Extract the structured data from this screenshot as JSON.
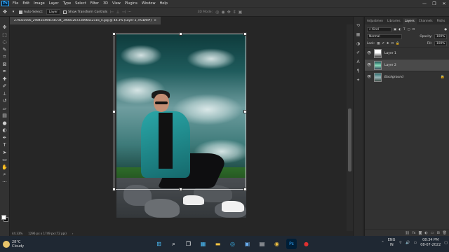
{
  "menubar": {
    "logo": "Ps",
    "items": [
      "File",
      "Edit",
      "Image",
      "Layer",
      "Type",
      "Select",
      "Filter",
      "3D",
      "View",
      "Plugins",
      "Window",
      "Help"
    ],
    "win_controls": [
      "—",
      "❐",
      "✕"
    ]
  },
  "options": {
    "auto_select_label": "Auto-Select:",
    "auto_select_value": "Layer",
    "transform_controls_label": "Show Transform Controls",
    "mode3d_label": "3D Mode:"
  },
  "document": {
    "tab_title": "274331056_298415494158734_3908126722896512116_n.jpg @ 44.3% (Layer 2, RGB/8#) *",
    "close": "×"
  },
  "statusbar": {
    "zoom": "44.33%",
    "doc_info": "1296 px x 1749 px (72 ppi)"
  },
  "panel": {
    "tabs": [
      "Adjustmen",
      "Libraries",
      "Layers",
      "Channels",
      "Paths"
    ],
    "kind_label": "Kind",
    "blend_mode": "Normal",
    "opacity_label": "Opacity:",
    "opacity_value": "100%",
    "lock_label": "Lock:",
    "fill_label": "Fill:",
    "fill_value": "100%",
    "layers": [
      {
        "name": "Layer 1",
        "selected": false,
        "locked": false
      },
      {
        "name": "Layer 2",
        "selected": true,
        "locked": false
      },
      {
        "name": "Background",
        "selected": false,
        "locked": true
      }
    ]
  },
  "taskbar": {
    "weather_temp": "28°C",
    "weather_desc": "Cloudy",
    "lang_top": "ENG",
    "lang_bottom": "IN",
    "time": "08:34 PM",
    "date": "08-07-2022"
  }
}
